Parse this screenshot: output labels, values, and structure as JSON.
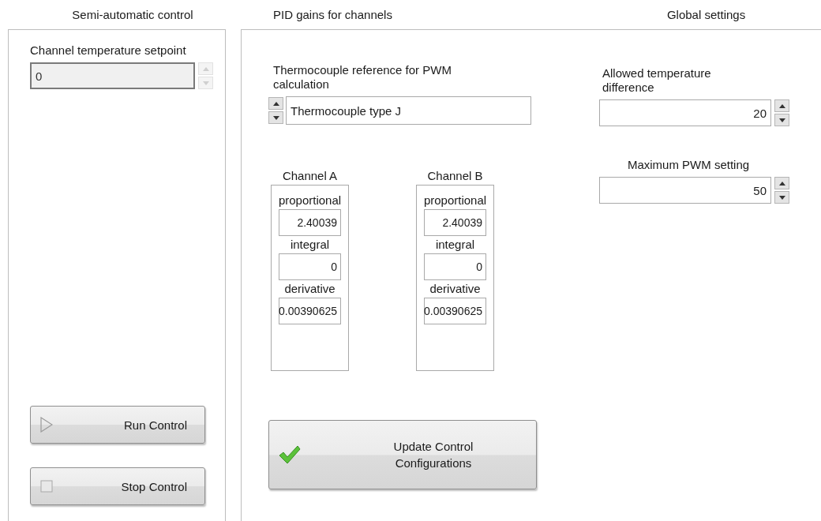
{
  "semi_automatic": {
    "title": "Semi-automatic control",
    "setpoint": {
      "label": "Channel temperature setpoint",
      "value": "0",
      "disabled": true
    },
    "buttons": [
      {
        "label": "Run Control",
        "kind": "run"
      },
      {
        "label": "Stop Control",
        "kind": "stop"
      }
    ]
  },
  "pid_gains": {
    "title": "PID gains for channels",
    "thermocouple": {
      "label": "Thermocouple reference for PWM calculation",
      "value": "Thermocouple type J"
    },
    "channels": [
      {
        "name": "Channel A",
        "gains": [
          {
            "label": "proportional",
            "value": "2.40039"
          },
          {
            "label": "integral",
            "value": "0"
          },
          {
            "label": "derivative",
            "value": "0.00390625"
          }
        ]
      },
      {
        "name": "Channel B",
        "gains": [
          {
            "label": "proportional",
            "value": "2.40039"
          },
          {
            "label": "integral",
            "value": "0"
          },
          {
            "label": "derivative",
            "value": "0.00390625"
          }
        ]
      }
    ],
    "update_button": {
      "label": "Update Control Configurations"
    }
  },
  "global_settings": {
    "title": "Global settings",
    "fields": [
      {
        "label": "Allowed temperature difference",
        "value": "20"
      },
      {
        "label": "Maximum PWM setting",
        "value": "50"
      }
    ]
  }
}
